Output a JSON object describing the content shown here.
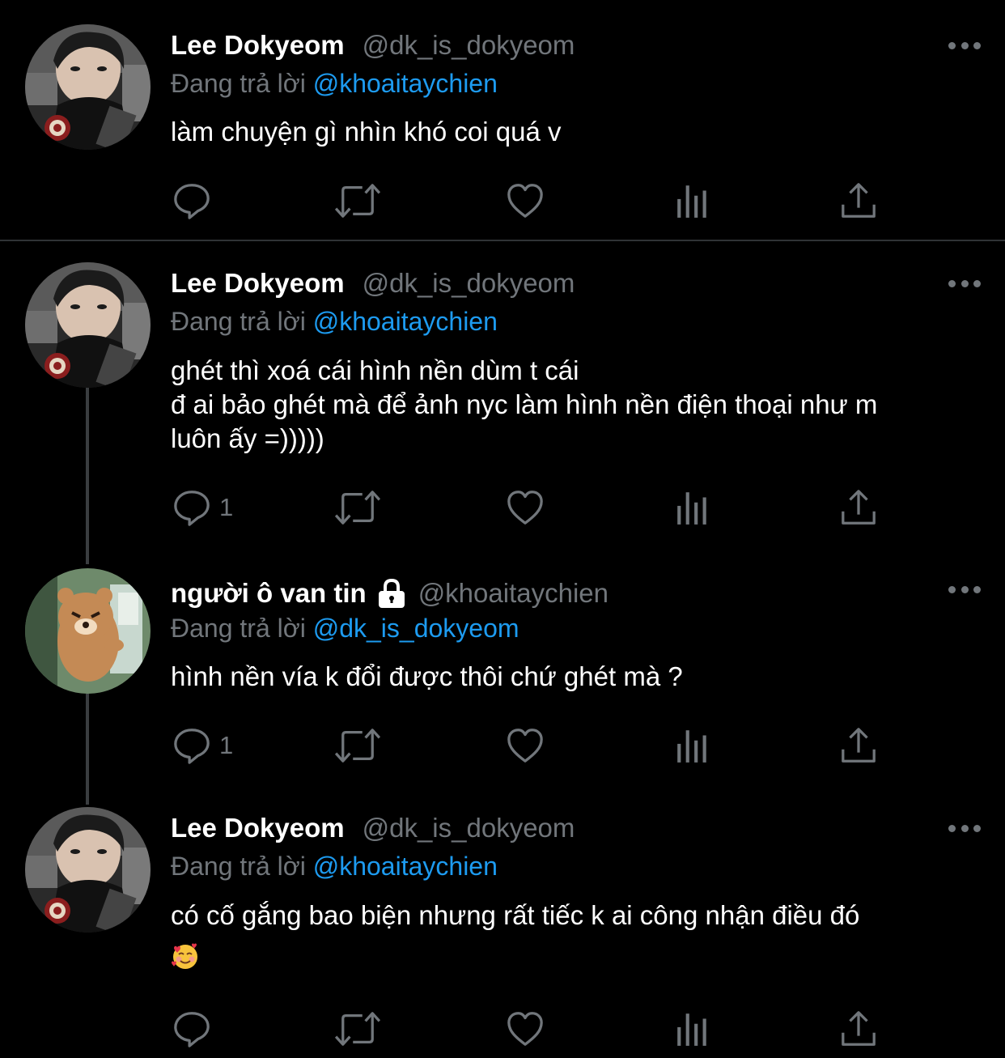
{
  "colors": {
    "background": "#000000",
    "name": "#ffffff",
    "secondary": "#71767b",
    "mention": "#1d9bf0",
    "divider": "#2f3336"
  },
  "tweets": [
    {
      "name": "Lee Dokyeom",
      "handle": "@dk_is_dokyeom",
      "replying_prefix": "Đang trả lời",
      "replying_to": "@khoaitaychien",
      "lines": [
        "làm chuyện gì nhìn khó coi quá v"
      ],
      "reply_count": "",
      "avatar": "avatar-photo-man"
    },
    {
      "name": "Lee Dokyeom",
      "handle": "@dk_is_dokyeom",
      "replying_prefix": "Đang trả lời",
      "replying_to": "@khoaitaychien",
      "lines": [
        "ghét thì xoá cái hình nền dùm t cái",
        "đ ai bảo ghét mà để ảnh nyc làm hình nền điện thoại như m",
        "luôn ấy =)))))"
      ],
      "reply_count": "1",
      "avatar": "avatar-photo-man"
    },
    {
      "name": "người ô van tin",
      "handle": "@khoaitaychien",
      "replying_prefix": "Đang trả lời",
      "replying_to": "@dk_is_dokyeom",
      "lines": [
        "hình nền vía k đổi được thôi chứ ghét mà ?"
      ],
      "reply_count": "1",
      "avatar": "avatar-cartoon-bear",
      "protected_icon": "lock-icon"
    },
    {
      "name": "Lee Dokyeom",
      "handle": "@dk_is_dokyeom",
      "replying_prefix": "Đang trả lời",
      "replying_to": "@khoaitaychien",
      "lines": [
        "có cố gắng bao biện nhưng rất tiếc k ai công nhận điều đó"
      ],
      "emoji": "smiling-face-with-hearts-emoji",
      "reply_count": "",
      "avatar": "avatar-photo-man"
    }
  ],
  "action_icons": [
    "reply-icon",
    "retweet-icon",
    "like-icon",
    "analytics-icon",
    "share-icon"
  ]
}
